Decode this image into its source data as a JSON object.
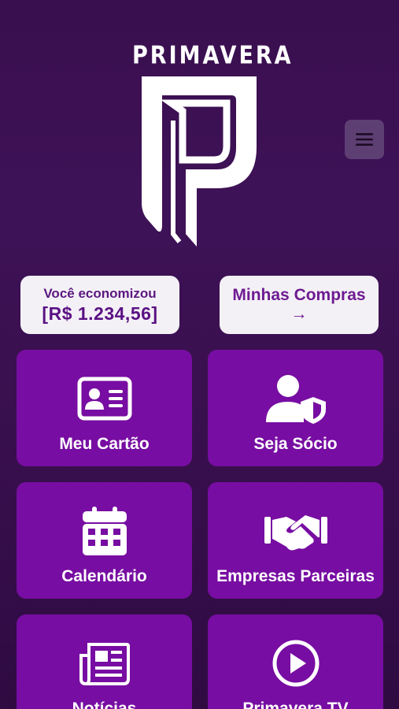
{
  "brand": {
    "name": "PRIMAVERA"
  },
  "header": {
    "menu_icon": "hamburger-icon"
  },
  "savings": {
    "label": "Você economizou",
    "amount": "[R$ 1.234,56]"
  },
  "purchases": {
    "label": "Minhas Compras",
    "arrow": "→"
  },
  "tiles": [
    {
      "label": "Meu Cartão",
      "icon": "id-card-icon"
    },
    {
      "label": "Seja Sócio",
      "icon": "user-shield-icon"
    },
    {
      "label": "Calendário",
      "icon": "calendar-icon"
    },
    {
      "label": "Empresas Parceiras",
      "icon": "handshake-icon"
    },
    {
      "label": "Notícias",
      "icon": "newspaper-icon"
    },
    {
      "label": "Primavera TV",
      "icon": "play-circle-icon"
    }
  ],
  "colors": {
    "background": "#3a0f4f",
    "tile": "#770da2",
    "pill": "#f4f1f6",
    "accent_text": "#6b1790"
  }
}
